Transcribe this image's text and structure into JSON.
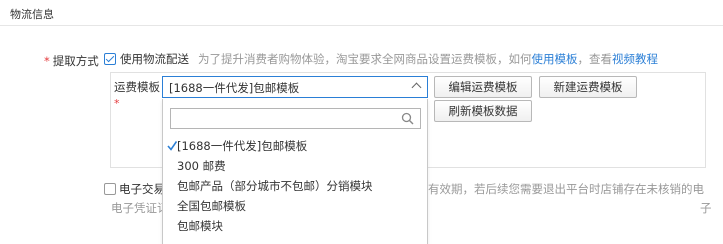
{
  "section": {
    "title": "物流信息"
  },
  "pickup": {
    "required_mark": "*",
    "label": "提取方式",
    "use_logistics_checked": true,
    "use_logistics_label": "使用物流配送",
    "hint_text": "为了提升消费者购物体验，淘宝要求全网商品设置运费模板，如何",
    "hint_link1": "使用模板",
    "hint_sep": "，查看",
    "hint_link2": "视频教程"
  },
  "template": {
    "label": "运费模板",
    "required_mark": "*",
    "selected": "[1688一件代发]包邮模板",
    "edit_button": "编辑运费模板",
    "new_button": "新建运费模板",
    "refresh_button": "刷新模板数据"
  },
  "dropdown": {
    "search_placeholder": "",
    "options": [
      {
        "label": "[1688一件代发]包邮模板",
        "selected": true
      },
      {
        "label": "300 邮费",
        "selected": false
      },
      {
        "label": "包邮产品（部分城市不包邮）分销模块",
        "selected": false
      },
      {
        "label": "全国包邮模板",
        "selected": false
      },
      {
        "label": "包邮模块",
        "selected": false
      }
    ]
  },
  "electronic": {
    "checked": false,
    "label_visible": "电子交易",
    "line2_visible": "电子凭证订单",
    "right_text": "有效期，若后续您需要退出平台时店铺存在未核销的电",
    "right_text2": "子"
  },
  "colors": {
    "accent": "#2b7fd6",
    "required": "#e4393c",
    "hint": "#999999"
  }
}
